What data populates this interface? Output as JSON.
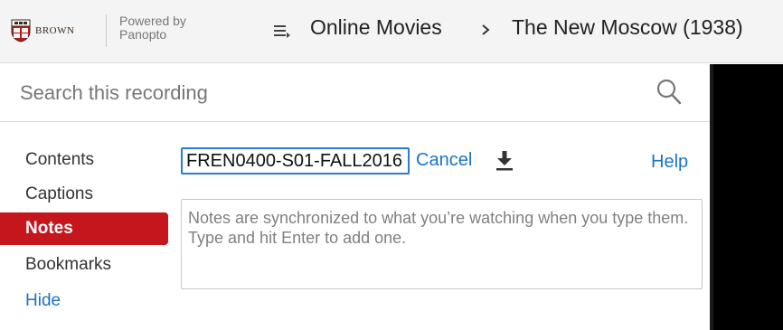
{
  "header": {
    "logo_text": "BROWN",
    "powered_line1": "Powered by",
    "powered_line2": "Panopto",
    "menu_icon": "menu-icon",
    "breadcrumb": [
      {
        "label": "Online Movies"
      },
      {
        "label": "The New Moscow (1938)"
      }
    ]
  },
  "search": {
    "placeholder": "Search this recording",
    "icon": "search-icon"
  },
  "sidebar": {
    "tabs": [
      {
        "label": "Contents",
        "active": false
      },
      {
        "label": "Captions",
        "active": false
      },
      {
        "label": "Notes",
        "active": true
      },
      {
        "label": "Bookmarks",
        "active": false
      },
      {
        "label": "Hide",
        "active": false
      }
    ]
  },
  "notes": {
    "channel_value": "FREN0400-S01-FALL2016",
    "cancel_label": "Cancel",
    "download_icon": "download-icon",
    "help_label": "Help",
    "placeholder": "Notes are synchronized to what you’re watching when you type them. Type and hit Enter to add one."
  },
  "colors": {
    "active_tab": "#c4161c",
    "link": "#1a73c8",
    "input_focus": "#2a7ad6",
    "header_bg": "#f4f4f4"
  }
}
